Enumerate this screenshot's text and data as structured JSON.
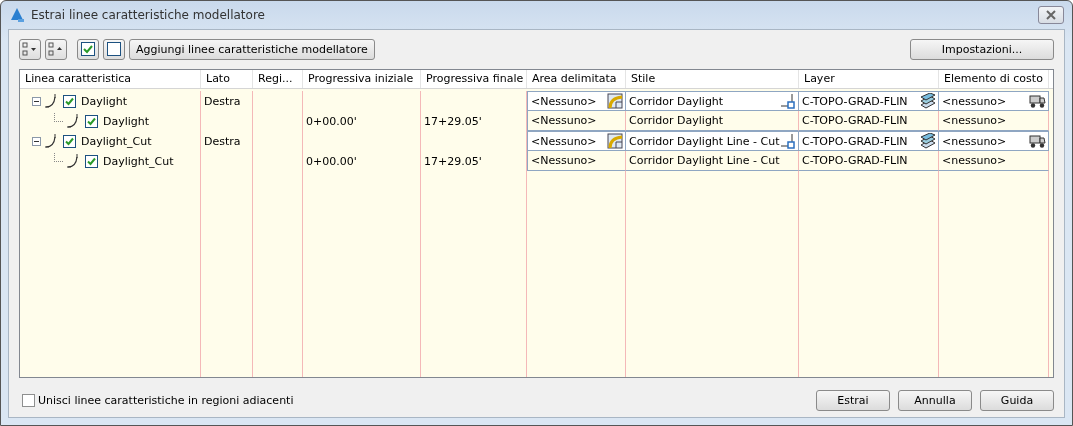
{
  "window": {
    "title": "Estrai linee caratteristiche modellatore"
  },
  "toolbar": {
    "add_button": "Aggiungi linee caratteristiche modellatore",
    "settings_button": "Impostazioni..."
  },
  "table": {
    "columns": [
      "Linea caratteristica",
      "Lato",
      "Regi...",
      "Progressiva iniziale",
      "Progressiva finale",
      "Area delimitata",
      "Stile",
      "Layer",
      "Elemento di costo"
    ],
    "rows": [
      {
        "name": "Daylight",
        "checked": true,
        "expanded": true,
        "side": "Destra",
        "area": "<Nessuno>",
        "style": "Corridor Daylight",
        "layer": "C-TOPO-GRAD-FLIN",
        "cost": "<nessuno>",
        "editable": true,
        "children": [
          {
            "name": "Daylight",
            "checked": true,
            "start": "0+00.00'",
            "end": "17+29.05'",
            "area": "<Nessuno>",
            "style": "Corridor Daylight",
            "layer": "C-TOPO-GRAD-FLIN",
            "cost": "<nessuno>",
            "editable": false
          }
        ]
      },
      {
        "name": "Daylight_Cut",
        "checked": true,
        "expanded": true,
        "side": "Destra",
        "area": "<Nessuno>",
        "style": "Corridor Daylight Line - Cut",
        "layer": "C-TOPO-GRAD-FLIN",
        "cost": "<nessuno>",
        "editable": true,
        "children": [
          {
            "name": "Daylight_Cut",
            "checked": true,
            "start": "0+00.00'",
            "end": "17+29.05'",
            "area": "<Nessuno>",
            "style": "Corridor Daylight Line - Cut",
            "layer": "C-TOPO-GRAD-FLIN",
            "cost": "<nessuno>",
            "editable": false
          }
        ]
      }
    ]
  },
  "merge_option": {
    "label": "Unisci linee caratteristiche in regioni adiacenti",
    "checked": false
  },
  "buttons": [
    "Estrai",
    "Annulla",
    "Guida"
  ]
}
